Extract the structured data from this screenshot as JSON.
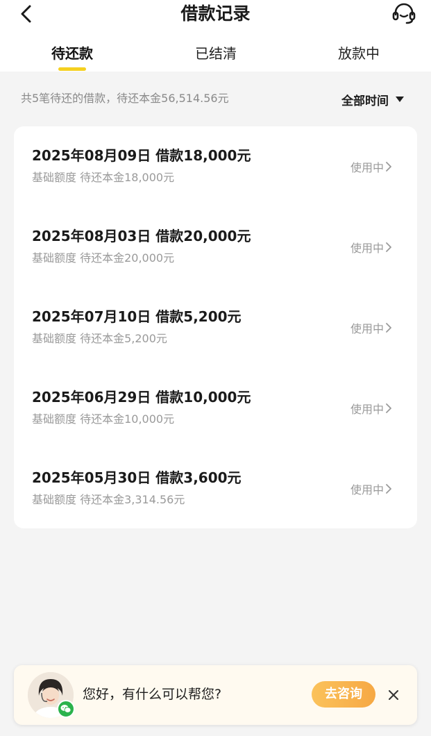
{
  "header": {
    "title": "借款记录"
  },
  "tabs": [
    {
      "label": "待还款"
    },
    {
      "label": "已结清"
    },
    {
      "label": "放款中"
    }
  ],
  "summary": {
    "text": "共5笔待还的借款，待还本金56,514.56元",
    "time_filter": "全部时间"
  },
  "loans": [
    {
      "title": "2025年08月09日 借款18,000元",
      "subtitle": "基础额度 待还本金18,000元",
      "status": "使用中"
    },
    {
      "title": "2025年08月03日 借款20,000元",
      "subtitle": "基础额度 待还本金20,000元",
      "status": "使用中"
    },
    {
      "title": "2025年07月10日 借款5,200元",
      "subtitle": "基础额度 待还本金5,200元",
      "status": "使用中"
    },
    {
      "title": "2025年06月29日 借款10,000元",
      "subtitle": "基础额度 待还本金10,000元",
      "status": "使用中"
    },
    {
      "title": "2025年05月30日 借款3,600元",
      "subtitle": "基础额度 待还本金3,314.56元",
      "status": "使用中"
    }
  ],
  "cs_banner": {
    "greeting": "您好，有什么可以帮您?",
    "button_label": "去咨询"
  },
  "colors": {
    "accent_yellow": "#f5d020",
    "button_orange": "#f6a844",
    "page_bg": "#f4f4f4",
    "wechat_green": "#2bb24c"
  },
  "icons": {
    "back": "back-arrow-icon",
    "customer_service": "headset-icon",
    "filter": "triangle-down-icon",
    "item_arrow": "chevron-right-icon",
    "close": "close-icon",
    "wechat": "wechat-icon"
  }
}
